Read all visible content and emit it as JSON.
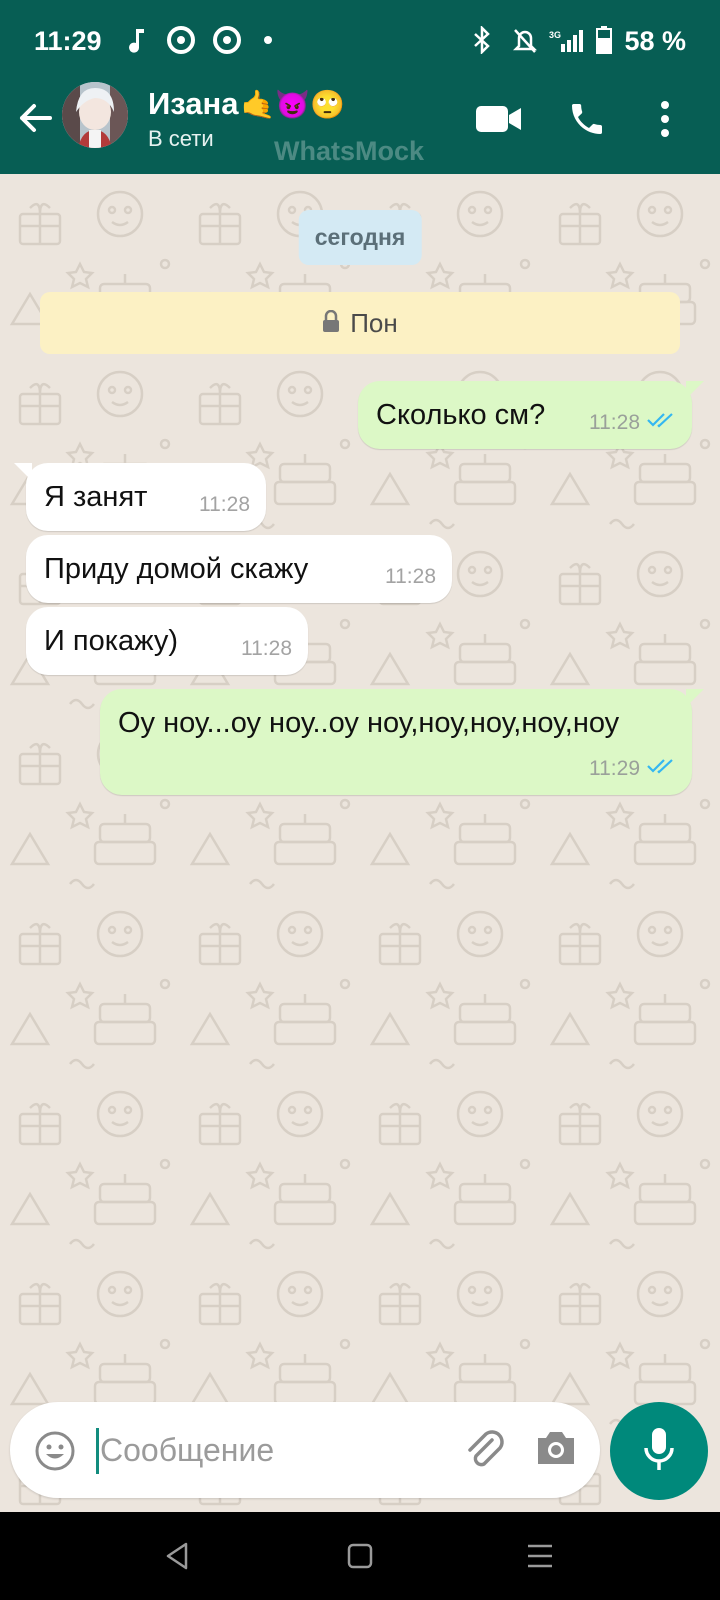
{
  "status_bar": {
    "time": "11:29",
    "battery": "58 %",
    "icons": [
      "music-note-icon",
      "chrome-icon",
      "chrome-icon",
      "dot-icon",
      "bluetooth-icon",
      "mute-icon",
      "signal-icon",
      "battery-icon"
    ]
  },
  "header": {
    "contact_name": "Изана",
    "name_emojis": "🤙😈🙄",
    "presence": "В сети",
    "watermark": "WhatsMock",
    "actions": [
      "video-call-icon",
      "voice-call-icon",
      "more-vert-icon"
    ]
  },
  "chat": {
    "date_chip": "сегодня",
    "system_note": "Пон",
    "messages": [
      {
        "direction": "out",
        "text": "Сколько см?",
        "time": "11:28",
        "status": "read"
      },
      {
        "direction": "in",
        "text": "Я занят",
        "time": "11:28"
      },
      {
        "direction": "in",
        "text": "Приду домой скажу",
        "time": "11:28"
      },
      {
        "direction": "in",
        "text": "И покажу)",
        "time": "11:28"
      },
      {
        "direction": "out",
        "text": "Оу ноу...оу ноу..оу ноу,ноу,ноу,ноу,ноу",
        "time": "11:29",
        "status": "read"
      }
    ]
  },
  "composer": {
    "placeholder": "Сообщение"
  },
  "colors": {
    "brand": "#075e54",
    "accent": "#00897b",
    "outgoing_bubble": "#dcf8c6",
    "incoming_bubble": "#ffffff",
    "read_ticks": "#34b7f1",
    "chat_bg": "#ece5dd"
  }
}
